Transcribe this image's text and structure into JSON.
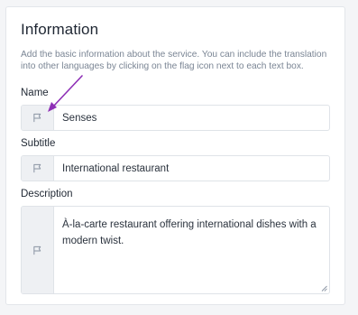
{
  "card": {
    "title": "Information",
    "description": "Add the basic information about the service. You can include the translation into other languages by clicking on the flag icon next to each text box."
  },
  "fields": {
    "name": {
      "label": "Name",
      "value": "Senses",
      "icon": "flag-icon"
    },
    "subtitle": {
      "label": "Subtitle",
      "value": "International restaurant",
      "icon": "flag-icon"
    },
    "description": {
      "label": "Description",
      "value": "À-la-carte restaurant offering international dishes with a modern twist.",
      "icon": "flag-icon"
    }
  },
  "annotation": {
    "icon": "arrow-icon",
    "color": "#8e2fb6"
  },
  "colors": {
    "flag_gray": "#8a94a3",
    "border": "#dfe3e8",
    "addon_bg": "#eef0f3"
  }
}
